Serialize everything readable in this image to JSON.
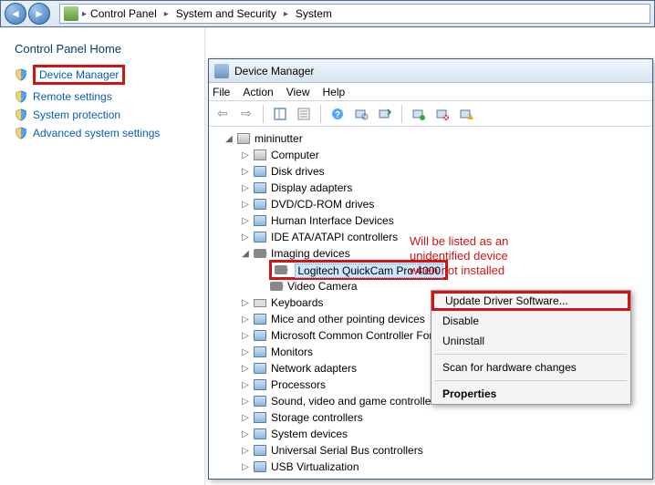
{
  "breadcrumb": {
    "items": [
      "Control Panel",
      "System and Security",
      "System"
    ]
  },
  "leftpane": {
    "home": "Control Panel Home",
    "links": {
      "device_manager": "Device Manager",
      "remote_settings": "Remote settings",
      "system_protection": "System protection",
      "advanced": "Advanced system settings"
    }
  },
  "dm": {
    "title": "Device Manager",
    "menus": {
      "file": "File",
      "action": "Action",
      "view": "View",
      "help": "Help"
    },
    "root": "mininutter",
    "categories": [
      {
        "label": "Computer",
        "expanded": false
      },
      {
        "label": "Disk drives",
        "expanded": false
      },
      {
        "label": "Display adapters",
        "expanded": false
      },
      {
        "label": "DVD/CD-ROM drives",
        "expanded": false
      },
      {
        "label": "Human Interface Devices",
        "expanded": false
      },
      {
        "label": "IDE ATA/ATAPI controllers",
        "expanded": false
      },
      {
        "label": "Imaging devices",
        "expanded": true,
        "children": [
          {
            "label": "Logitech QuickCam Pro 4000",
            "selected": true
          },
          {
            "label": "Video Camera",
            "selected": false
          }
        ]
      },
      {
        "label": "Keyboards",
        "expanded": false
      },
      {
        "label": "Mice and other pointing devices",
        "expanded": false
      },
      {
        "label": "Microsoft Common Controller For Windows Class",
        "expanded": false
      },
      {
        "label": "Monitors",
        "expanded": false
      },
      {
        "label": "Network adapters",
        "expanded": false
      },
      {
        "label": "Processors",
        "expanded": false
      },
      {
        "label": "Sound, video and game controllers",
        "expanded": false
      },
      {
        "label": "Storage controllers",
        "expanded": false
      },
      {
        "label": "System devices",
        "expanded": false
      },
      {
        "label": "Universal Serial Bus controllers",
        "expanded": false
      },
      {
        "label": "USB Virtualization",
        "expanded": false
      }
    ]
  },
  "annotation": {
    "line1": "Will be listed as an",
    "line2": "unidentified device",
    "line3": "when not installed"
  },
  "context_menu": {
    "update": "Update Driver Software...",
    "disable": "Disable",
    "uninstall": "Uninstall",
    "scan": "Scan for hardware changes",
    "properties": "Properties"
  }
}
